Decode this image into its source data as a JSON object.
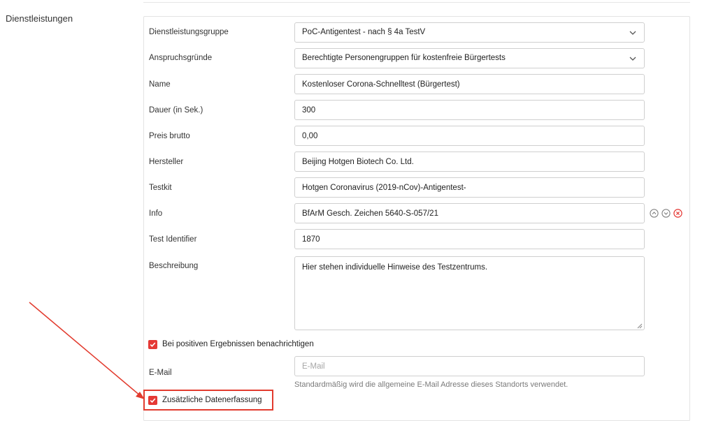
{
  "section": {
    "title": "Dienstleistungen"
  },
  "fields": {
    "group": {
      "label": "Dienstleistungsgruppe",
      "value": "PoC-Antigentest - nach § 4a TestV"
    },
    "claims": {
      "label": "Anspruchsgründe",
      "value": "Berechtigte Personengruppen für kostenfreie Bürgertests"
    },
    "name": {
      "label": "Name",
      "value": "Kostenloser Corona-Schnelltest (Bürgertest)"
    },
    "duration": {
      "label": "Dauer (in Sek.)",
      "value": "300"
    },
    "price": {
      "label": "Preis brutto",
      "value": "0,00"
    },
    "manufacturer": {
      "label": "Hersteller",
      "value": "Beijing Hotgen Biotech Co. Ltd."
    },
    "testkit": {
      "label": "Testkit",
      "value": "Hotgen Coronavirus (2019-nCov)-Antigentest-"
    },
    "info": {
      "label": "Info",
      "value": "BfArM Gesch. Zeichen 5640-S-057/21"
    },
    "identifier": {
      "label": "Test Identifier",
      "value": "1870"
    },
    "description": {
      "label": "Beschreibung",
      "value": "Hier stehen individuelle Hinweise des Testzentrums."
    },
    "email": {
      "label": "E-Mail",
      "value": "",
      "placeholder": "E-Mail",
      "hint": "Standardmäßig wird die allgemeine E-Mail Adresse dieses Standorts verwendet."
    }
  },
  "checkboxes": {
    "notify_positive": {
      "label": "Bei positiven Ergebnissen benachrichtigen",
      "checked": true
    },
    "extra_data": {
      "label": "Zusätzliche Datenerfassung",
      "checked": true
    }
  },
  "icons": {
    "move_up": "chevron-up-circle-icon",
    "move_down": "chevron-down-circle-icon",
    "remove": "close-circle-icon"
  },
  "colors": {
    "accent": "#e53935",
    "annotation": "#e23b2e",
    "border": "#cfcfcf"
  }
}
